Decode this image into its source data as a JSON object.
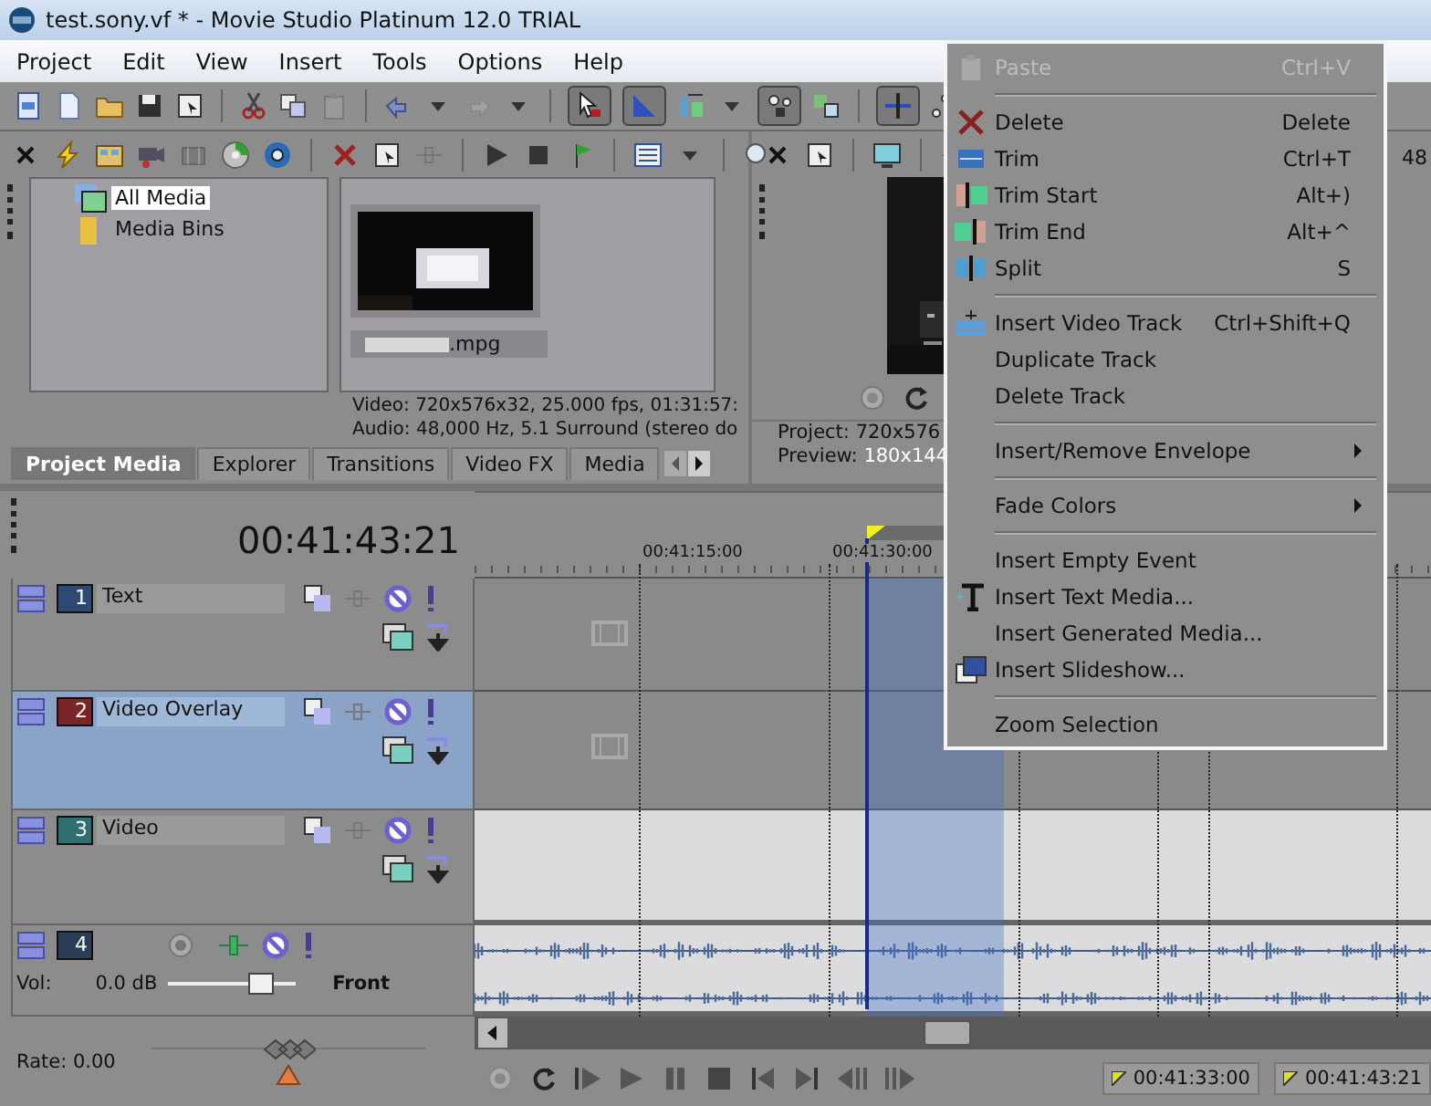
{
  "window": {
    "title": "test.sony.vf * - Movie Studio Platinum 12.0 TRIAL"
  },
  "menu_bar": [
    "Project",
    "Edit",
    "View",
    "Insert",
    "Tools",
    "Options",
    "Help"
  ],
  "media_tree": [
    {
      "label": "All Media",
      "selected": true
    },
    {
      "label": "Media Bins",
      "selected": false
    }
  ],
  "media_file": {
    "name": ".mpg",
    "kind": "picture"
  },
  "media_info": [
    "Video: 720x576x32, 25.000 fps, 01:31:57:",
    "Audio: 48,000 Hz, 5.1 Surround (stereo do"
  ],
  "panel_tabs": [
    {
      "label": "Project Media",
      "selected": true
    },
    {
      "label": "Explorer",
      "selected": false
    },
    {
      "label": "Transitions",
      "selected": false
    },
    {
      "label": "Video FX",
      "selected": false
    },
    {
      "label": "Media",
      "selected": false
    }
  ],
  "preview": {
    "project_label": "Project:",
    "project_value": "720x576",
    "preview_label": "Preview:",
    "preview_value": "180x144"
  },
  "right_panel": {
    "text": "48"
  },
  "time": "00:41:43:21",
  "tracks": [
    {
      "kind": "video",
      "number": "1",
      "name": "Text",
      "selected": false,
      "color": "#2c4a72"
    },
    {
      "kind": "video",
      "number": "2",
      "name": "Video Overlay",
      "selected": true,
      "color": "#7a2626"
    },
    {
      "kind": "video",
      "number": "3",
      "name": "Video",
      "selected": false,
      "color": "#2f6f72"
    },
    {
      "kind": "audio",
      "number": "4",
      "volume_label": "Vol:",
      "volume": "0.0 dB",
      "level": 0.72,
      "pan": "Front",
      "selected": false,
      "color": "#2a3c56"
    }
  ],
  "rate": {
    "label": "Rate: 0.00",
    "level": 0.5
  },
  "ruler": [
    "00:41:15:00",
    "00:41:30:00"
  ],
  "status_times": [
    "00:41:33:00",
    "00:41:43:21"
  ],
  "context_menu": [
    {
      "kind": "item",
      "label": "Paste",
      "shortcut": "Ctrl+V",
      "disabled": true
    },
    {
      "kind": "separator"
    },
    {
      "kind": "item",
      "label": "Delete",
      "shortcut": "Delete",
      "disabled": false
    },
    {
      "kind": "item",
      "label": "Trim",
      "shortcut": "Ctrl+T",
      "disabled": false
    },
    {
      "kind": "item",
      "label": "Trim Start",
      "shortcut": "Alt+)",
      "disabled": false
    },
    {
      "kind": "item",
      "label": "Trim End",
      "shortcut": "Alt+^",
      "disabled": false
    },
    {
      "kind": "item",
      "label": "Split",
      "shortcut": "S",
      "disabled": false
    },
    {
      "kind": "separator"
    },
    {
      "kind": "item",
      "label": "Insert Video Track",
      "shortcut": "Ctrl+Shift+Q",
      "disabled": false
    },
    {
      "kind": "item",
      "label": "Duplicate Track",
      "disabled": false
    },
    {
      "kind": "item",
      "label": "Delete Track",
      "disabled": false
    },
    {
      "kind": "separator"
    },
    {
      "kind": "submenu",
      "label": "Insert/Remove Envelope",
      "disabled": false
    },
    {
      "kind": "separator"
    },
    {
      "kind": "submenu",
      "label": "Fade Colors",
      "disabled": false
    },
    {
      "kind": "separator"
    },
    {
      "kind": "item",
      "label": "Insert Empty Event",
      "disabled": false
    },
    {
      "kind": "item",
      "label": "Insert Text Media...",
      "disabled": false
    },
    {
      "kind": "item",
      "label": "Insert Generated Media...",
      "disabled": false
    },
    {
      "kind": "item",
      "label": "Insert Slideshow...",
      "disabled": false
    },
    {
      "kind": "separator"
    },
    {
      "kind": "item",
      "label": "Zoom Selection",
      "disabled": false
    }
  ]
}
